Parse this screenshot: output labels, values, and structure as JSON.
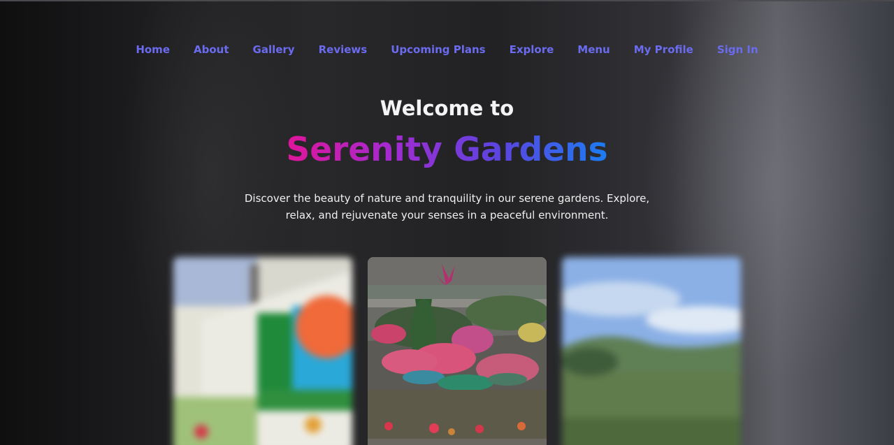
{
  "nav": {
    "items": [
      {
        "label": "Home"
      },
      {
        "label": "About"
      },
      {
        "label": "Gallery"
      },
      {
        "label": "Reviews"
      },
      {
        "label": "Upcoming Plans"
      },
      {
        "label": "Explore"
      },
      {
        "label": "Menu"
      },
      {
        "label": "My Profile"
      },
      {
        "label": "Sign In"
      }
    ],
    "link_color": "#6b6bf0"
  },
  "hero": {
    "welcome": "Welcome to",
    "brand": "Serenity Gardens",
    "brand_gradient": [
      "#e0159a",
      "#a22bd0",
      "#5a45e0",
      "#1b7df3"
    ],
    "tagline": "Discover the beauty of nature and tranquility in our serene gardens. Explore, relax, and rejuvenate your senses in a peaceful environment."
  },
  "gallery": {
    "cards": [
      {
        "subject": "blurred colorful wall mural with flowers",
        "state": "blurred"
      },
      {
        "subject": "garden with pink flowers in painted tyre planters",
        "state": "focused"
      },
      {
        "subject": "blurred landscape of blue sky and green hills",
        "state": "blurred"
      }
    ]
  }
}
